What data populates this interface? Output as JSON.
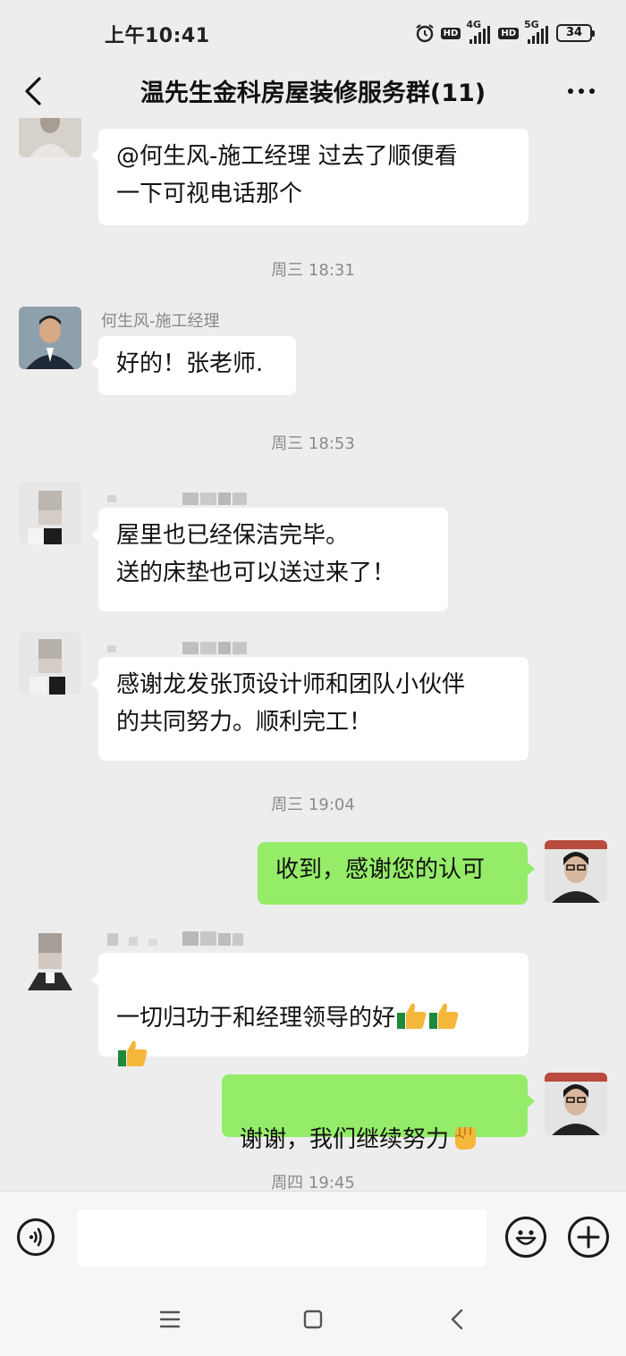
{
  "status_bar": {
    "time": "上午10:41",
    "network_1": "4G",
    "network_2": "5G",
    "hd": "HD",
    "battery": "34"
  },
  "header": {
    "title": "温先生金科房屋装修服务群(11)"
  },
  "timestamps": {
    "t1": "周三 18:31",
    "t2": "周三 18:53",
    "t3": "周三 19:04",
    "t4": "周四 19:45"
  },
  "messages": {
    "m1": {
      "text": "@何生风-施工经理  过去了顺便看\n一下可视电话那个"
    },
    "m2": {
      "sender": "何生风-施工经理",
      "text": "好的！张老师."
    },
    "m3": {
      "text": "屋里也已经保洁完毕。\n送的床垫也可以送过来了！"
    },
    "m4": {
      "text": "感谢龙发张顶设计师和团队小伙伴\n的共同努力。顺利完工！"
    },
    "m5": {
      "text": "收到，感谢您的认可"
    },
    "m6": {
      "text": "一切归功于和经理领导的好"
    },
    "m7": {
      "text": "谢谢，我们继续努力"
    }
  },
  "icons": {
    "back": "chevron-left-icon",
    "more": "more-dots-icon",
    "voice": "voice-icon",
    "emoji": "emoji-icon",
    "plus": "plus-icon",
    "thumbs_up": "thumbs-up-icon",
    "fist": "fist-icon"
  },
  "colors": {
    "incoming_bubble": "#ffffff",
    "outgoing_bubble": "#95ec69",
    "background": "#ededed"
  }
}
